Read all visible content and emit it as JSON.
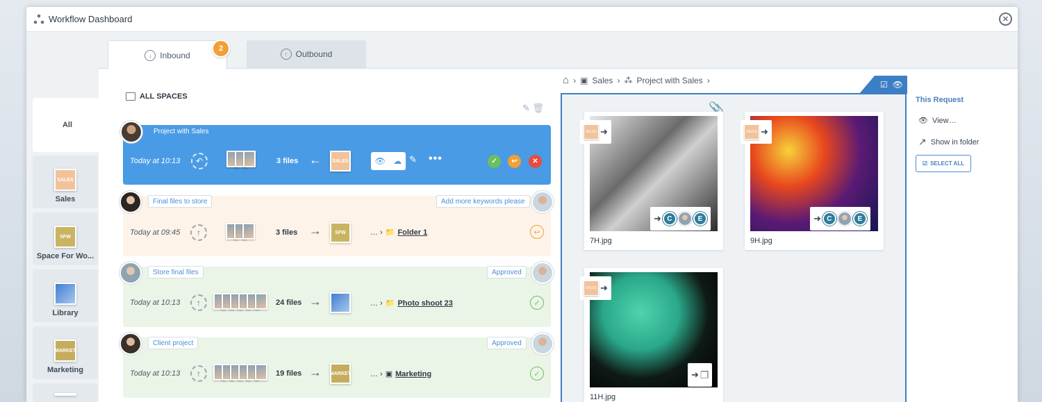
{
  "window": {
    "title": "Workflow Dashboard"
  },
  "tabs": [
    {
      "label": "Inbound",
      "badge": "2"
    },
    {
      "label": "Outbound"
    }
  ],
  "sidebar": {
    "items": [
      {
        "label": "All"
      },
      {
        "label": "Sales",
        "thumb_text": "SALES"
      },
      {
        "label": "Space For Wo...",
        "thumb_text": "SFW"
      },
      {
        "label": "Library"
      },
      {
        "label": "Marketing",
        "thumb_text": "MARKET"
      }
    ]
  },
  "list": {
    "heading": "ALL SPACES",
    "rows": [
      {
        "label": "Project with Sales",
        "time": "Today at 10:13",
        "count": "3 files",
        "dest_text": "SALES",
        "state": "active"
      },
      {
        "label": "Final files to store",
        "right_label": "Add more keywords please",
        "time": "Today at 09:45",
        "count": "3 files",
        "dest_text": "SFW",
        "folder": "Folder 1",
        "state": "pending"
      },
      {
        "label": "Store final files",
        "right_label": "Approved",
        "time": "Today at 10:13",
        "count": "24 files",
        "folder": "Photo shoot 23",
        "state": "approved"
      },
      {
        "label": "Client project",
        "right_label": "Approved",
        "time": "Today at 10:13",
        "count": "19 files",
        "dest_text": "MARKET",
        "folder": "Marketing",
        "state": "approved"
      }
    ]
  },
  "breadcrumb": {
    "items": [
      "Sales",
      "Project with Sales"
    ]
  },
  "preview": {
    "files": [
      {
        "name": "7H.jpg",
        "tag": "SALES"
      },
      {
        "name": "9H.jpg",
        "tag": "SALES"
      },
      {
        "name": "11H.jpg",
        "tag": "SALES"
      }
    ],
    "user_initials": [
      "C",
      "E"
    ]
  },
  "request": {
    "title": "This Request",
    "view": "View…",
    "show_in_folder": "Show in folder",
    "select_all": "SELECT ALL"
  },
  "colors": {
    "accent": "#4a9be5",
    "badge": "#f0a035",
    "approved": "#6cc05c",
    "reject": "#e84c3d"
  }
}
